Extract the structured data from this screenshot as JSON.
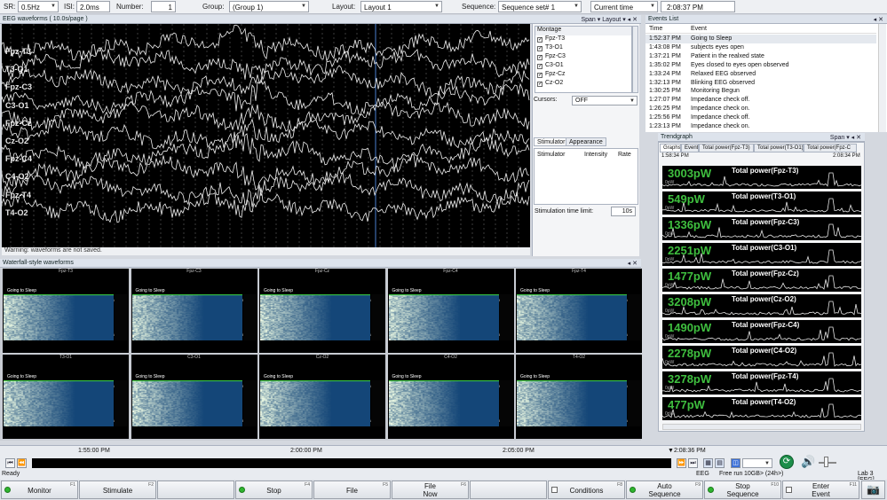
{
  "toolbar": {
    "sr_label": "SR:",
    "sr_value": "0.5Hz",
    "isi_label": "ISI:",
    "isi_value": "2.0ms",
    "number_label": "Number:",
    "number_value": "1",
    "group_label": "Group:",
    "group_value": "(Group 1)",
    "layout_label": "Layout:",
    "layout_value": "Layout 1",
    "sequence_label": "Sequence:",
    "sequence_value": "Sequence set# 1",
    "time_mode_value": "Current time",
    "clock": "2:08:37 PM"
  },
  "eeg": {
    "title": "EEG waveforms ( 10.0s/page )",
    "span_label": "Span",
    "layout_label": "Layout",
    "channels": [
      "Fpz-T3",
      "T3-O1",
      "Fpz-C3",
      "C3-O1",
      "Fpz-Cz",
      "Cz-O2",
      "Fpz-C4",
      "C4-O2",
      "Fpz-T4",
      "T4-O2"
    ],
    "warning": "Warning: waveforms are not saved."
  },
  "montage": {
    "header": "Montage",
    "items": [
      "Fpz-T3",
      "T3-O1",
      "Fpz-C3",
      "C3-O1",
      "Fpz-Cz",
      "Cz-O2"
    ],
    "cursors_label": "Cursors:",
    "cursors_value": "OFF"
  },
  "stimulator": {
    "tab_stimulator": "Stimulator",
    "tab_appearance": "Appearance",
    "col_stimulator": "Stimulator",
    "col_intensity": "Intensity",
    "col_rate": "Rate",
    "time_limit_label": "Stimulation time limit:",
    "time_limit_value": "10s"
  },
  "waterfall": {
    "title": "Waterfall-style waveforms",
    "cells": [
      {
        "title": "Fpz-T3",
        "event": "Going to Sleep",
        "t1": "2:08:32 PM",
        "t2": "2:08:30 PM"
      },
      {
        "title": "Fpz-C3",
        "event": "Going to Sleep",
        "t1": "2:08:32 PM",
        "t2": "2:08:30 PM"
      },
      {
        "title": "Fpz-Cz",
        "event": "Going to Sleep",
        "t1": "2:08:32 PM",
        "t2": "2:08:30 PM"
      },
      {
        "title": "Fpz-C4",
        "event": "Going to Sleep",
        "t1": "2:08:32 PM",
        "t2": "2:08:30 PM"
      },
      {
        "title": "Fpz-T4",
        "event": "Going to Sleep",
        "t1": "2:08:32 PM",
        "t2": "2:08:30 PM"
      },
      {
        "title": "T3-O1",
        "event": "Going to Sleep",
        "t1": "2:08:32 PM",
        "t2": "2:08:30 PM"
      },
      {
        "title": "C3-O1",
        "event": "Going to Sleep",
        "t1": "2:08:32 PM",
        "t2": "2:08:30 PM"
      },
      {
        "title": "Cz-O2",
        "event": "Going to Sleep",
        "t1": "2:08:32 PM",
        "t2": "2:08:30 PM"
      },
      {
        "title": "C4-O2",
        "event": "Going to Sleep",
        "t1": "2:08:32 PM",
        "t2": "2:08:30 PM"
      },
      {
        "title": "T4-O2",
        "event": "Going to Sleep",
        "t1": "2:08:32 PM",
        "t2": "2:08:30 PM"
      }
    ]
  },
  "events": {
    "title": "Events List",
    "col_time": "Time",
    "col_event": "Event",
    "rows": [
      {
        "time": "1:52:37 PM",
        "event": "Going to Sleep"
      },
      {
        "time": "1:43:08 PM",
        "event": "subjects eyes open"
      },
      {
        "time": "1:37:21 PM",
        "event": "Patient in the realxed state"
      },
      {
        "time": "1:35:02 PM",
        "event": "Eyes closed to eyes open observed"
      },
      {
        "time": "1:33:24 PM",
        "event": "Relaxed EEG observed"
      },
      {
        "time": "1:32:13 PM",
        "event": "Blinking EEG observed"
      },
      {
        "time": "1:30:25 PM",
        "event": "Monitoring Begun"
      },
      {
        "time": "1:27:07 PM",
        "event": "Impedance check off."
      },
      {
        "time": "1:26:25 PM",
        "event": "Impedance check on."
      },
      {
        "time": "1:25:56 PM",
        "event": "Impedance check off."
      },
      {
        "time": "1:23:13 PM",
        "event": "Impedance check on."
      }
    ]
  },
  "trend": {
    "title": "Trendgraph",
    "span_label": "Span",
    "tabs": [
      "Graphs",
      "Event",
      "Total power(Fpz-T3)",
      "Total power(T3-O1)",
      "Total power(Fpz-C"
    ],
    "start_time": "1:58:34 PM",
    "end_time": "2:08:34 PM",
    "unit": "0pW",
    "rows": [
      {
        "value": "3003pW",
        "name": "Total power(Fpz-T3)"
      },
      {
        "value": "549pW",
        "name": "Total power(T3-O1)"
      },
      {
        "value": "1336pW",
        "name": "Total power(Fpz-C3)"
      },
      {
        "value": "2251pW",
        "name": "Total power(C3-O1)"
      },
      {
        "value": "1477pW",
        "name": "Total power(Fpz-Cz)"
      },
      {
        "value": "3208pW",
        "name": "Total power(Cz-O2)"
      },
      {
        "value": "1490pW",
        "name": "Total power(Fpz-C4)"
      },
      {
        "value": "2278pW",
        "name": "Total power(C4-O2)"
      },
      {
        "value": "3278pW",
        "name": "Total power(Fpz-T4)"
      },
      {
        "value": "477pW",
        "name": "Total power(T4-O2)"
      }
    ]
  },
  "timeline": {
    "ticks": [
      "1:55:00 PM",
      "2:00:00 PM",
      "2:05:00 PM"
    ],
    "current": "2:08:36 PM"
  },
  "status": {
    "ready": "Ready",
    "eeg": "EEG",
    "free_run": "Free run",
    "storage": "10GB> (24h>)",
    "lab": "Lab 3 [EEG]"
  },
  "buttons": {
    "monitor": "Monitor",
    "monitor_key": "F1",
    "stimulate": "Stimulate",
    "stimulate_key": "F2",
    "stop": "Stop",
    "stop_key": "F4",
    "file": "File",
    "file_key": "F5",
    "file_now_1": "File",
    "file_now_2": "Now",
    "file_now_key": "F6",
    "conditions": "Conditions",
    "conditions_key": "F8",
    "auto_seq_1": "Auto",
    "auto_seq_2": "Sequence",
    "auto_seq_key": "F9",
    "stop_seq_1": "Stop",
    "stop_seq_2": "Sequence",
    "stop_seq_key": "F10",
    "enter_event_1": "Enter",
    "enter_event_2": "Event",
    "enter_event_key": "F11"
  }
}
